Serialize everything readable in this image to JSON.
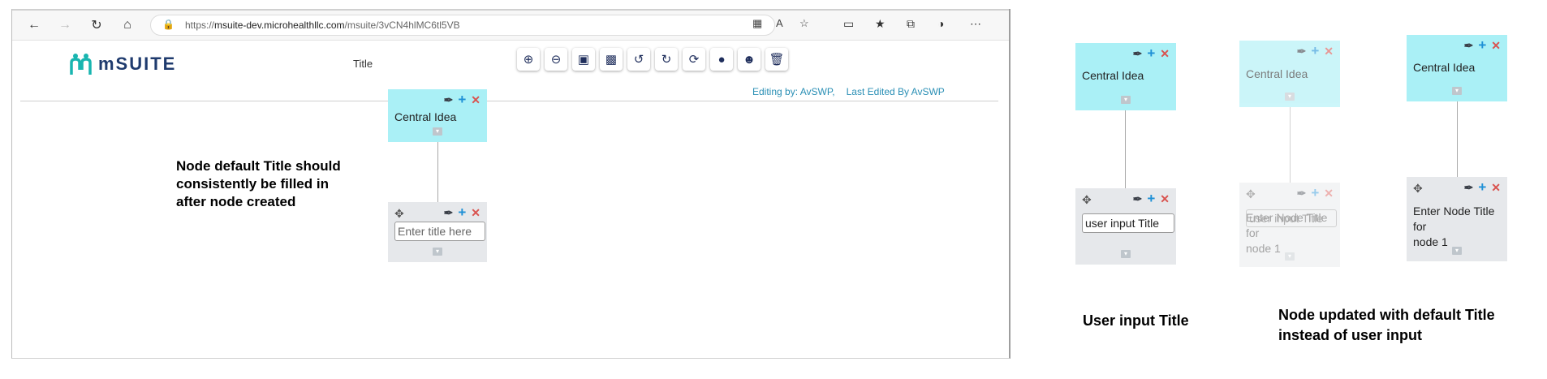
{
  "browser": {
    "url_prefix": "https://",
    "url_host": "msuite-dev.microhealthllc.com",
    "url_path": "/msuite/3vCN4hlMC6tl5VB"
  },
  "app": {
    "logo_text": "mSUITE",
    "title": "Title",
    "editing_by": "Editing by: AvSWP,",
    "last_edited": "Last Edited By AvSWP"
  },
  "main_map": {
    "central_label": "Central Idea",
    "child_placeholder": "Enter title here"
  },
  "annotation_left": {
    "line1": "Node default Title should",
    "line2": "consistently be filled in",
    "line3": "after node created"
  },
  "panel1": {
    "central_label": "Central Idea",
    "input_value": "user input Title",
    "caption": "User input Title"
  },
  "panel2": {
    "central_label": "Central Idea",
    "ghost_text": "user input Title",
    "node_line1": "Enter Node Title for",
    "node_line2": "node 1"
  },
  "panel3": {
    "central_label": "Central Idea",
    "node_line1": "Enter Node Title for",
    "node_line2": "node 1"
  },
  "caption_right": {
    "line1": "Node updated with default Title",
    "line2": "instead of user input"
  },
  "colors": {
    "central_node": "#aaf0f6",
    "child_node": "#e6e8eb",
    "plus_icon": "#1e90d6",
    "close_icon": "#d9534f",
    "editing_text": "#2a8fb5",
    "logo": "#1f3b6e"
  }
}
